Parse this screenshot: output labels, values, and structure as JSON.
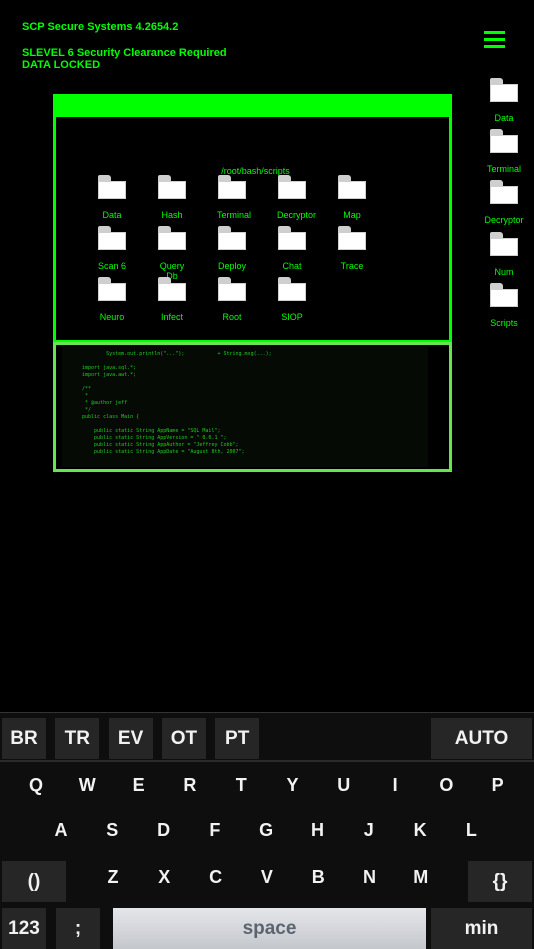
{
  "header": {
    "system": "SCP Secure Systems 4.2654.2",
    "clearance": "SLEVEL 6 Security Clearance Required",
    "status": "DATA LOCKED"
  },
  "menu_icon": "hamburger-menu-icon",
  "sidebar": [
    {
      "label": "Data"
    },
    {
      "label": "Terminal"
    },
    {
      "label": "Decryptor"
    },
    {
      "label": "Num"
    },
    {
      "label": "Scripts"
    }
  ],
  "window": {
    "path": "/root/bash/scripts",
    "folders": [
      [
        "Data",
        "Hash",
        "Terminal",
        "Decryptor",
        "Map"
      ],
      [
        "Scan 6",
        "Query Db",
        "Deploy",
        "Chat",
        "Trace"
      ],
      [
        "Neuro",
        "Infect",
        "Root",
        "SIOP"
      ]
    ],
    "code": "        System.out.println(\"...\");           + String.msg(...);\n\nimport java.sql.*;\nimport java.awt.*;\n\n/**\n *\n * @author jeff\n */\npublic class Main {\n\n    public static String AppName = \"SQL Mail\";\n    public static String AppVersion = \" 0.0.1 \";\n    public static String AppAuthor = \"Jeffrey Cobb\";\n    public static String AppDate = \"August 8th, 2007\";"
  },
  "colors": {
    "accent": "#00ff00",
    "code_border": "#66e64d"
  },
  "keyboard": {
    "suggestions": [
      "BR",
      "TR",
      "EV",
      "OT",
      "PT"
    ],
    "auto": "AUTO",
    "row1": [
      "Q",
      "W",
      "E",
      "R",
      "T",
      "Y",
      "U",
      "I",
      "O",
      "P"
    ],
    "row2": [
      "A",
      "S",
      "D",
      "F",
      "G",
      "H",
      "J",
      "K",
      "L"
    ],
    "row3": [
      "Z",
      "X",
      "C",
      "V",
      "B",
      "N",
      "M"
    ],
    "paren": "()",
    "brace": "{}",
    "num": "123",
    "semicolon": ";",
    "space": "space",
    "min": "min"
  }
}
